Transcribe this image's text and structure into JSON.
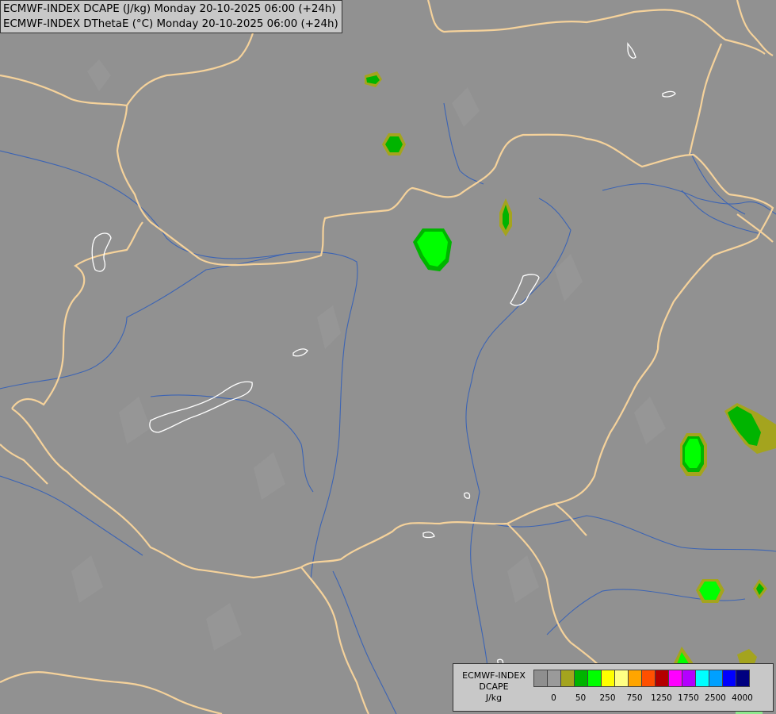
{
  "header": {
    "line1": "ECMWF-INDEX DCAPE (J/kg) Monday 20-10-2025 06:00 (+24h)",
    "line2": "ECMWF-INDEX DThetaE (°C) Monday 20-10-2025 06:00 (+24h)"
  },
  "legend": {
    "title": "ECMWF-INDEX",
    "variable": "DCAPE",
    "unit": "J/kg",
    "colors": [
      "#8f8f8f",
      "#9a9a9a",
      "#a4a41e",
      "#00b400",
      "#00ff00",
      "#ffff00",
      "#ffff84",
      "#ffa500",
      "#ff5000",
      "#b40000",
      "#ff00ff",
      "#b400ff",
      "#00ffff",
      "#00a0ff",
      "#0000ff",
      "#000080"
    ],
    "ticks": [
      {
        "label": "0",
        "index": 1
      },
      {
        "label": "50",
        "index": 3
      },
      {
        "label": "250",
        "index": 5
      },
      {
        "label": "750",
        "index": 7
      },
      {
        "label": "1250",
        "index": 9
      },
      {
        "label": "1750",
        "index": 11
      },
      {
        "label": "2500",
        "index": 13
      },
      {
        "label": "4000",
        "index": 15
      }
    ]
  },
  "map": {
    "background": "#919191",
    "border_color": "#f5d29b",
    "river_color": "#3c64b4",
    "lake_color": "#ffffff",
    "fill_colors": {
      "low": "#a4a41e",
      "mid": "#00b400",
      "high": "#00ff00"
    }
  }
}
